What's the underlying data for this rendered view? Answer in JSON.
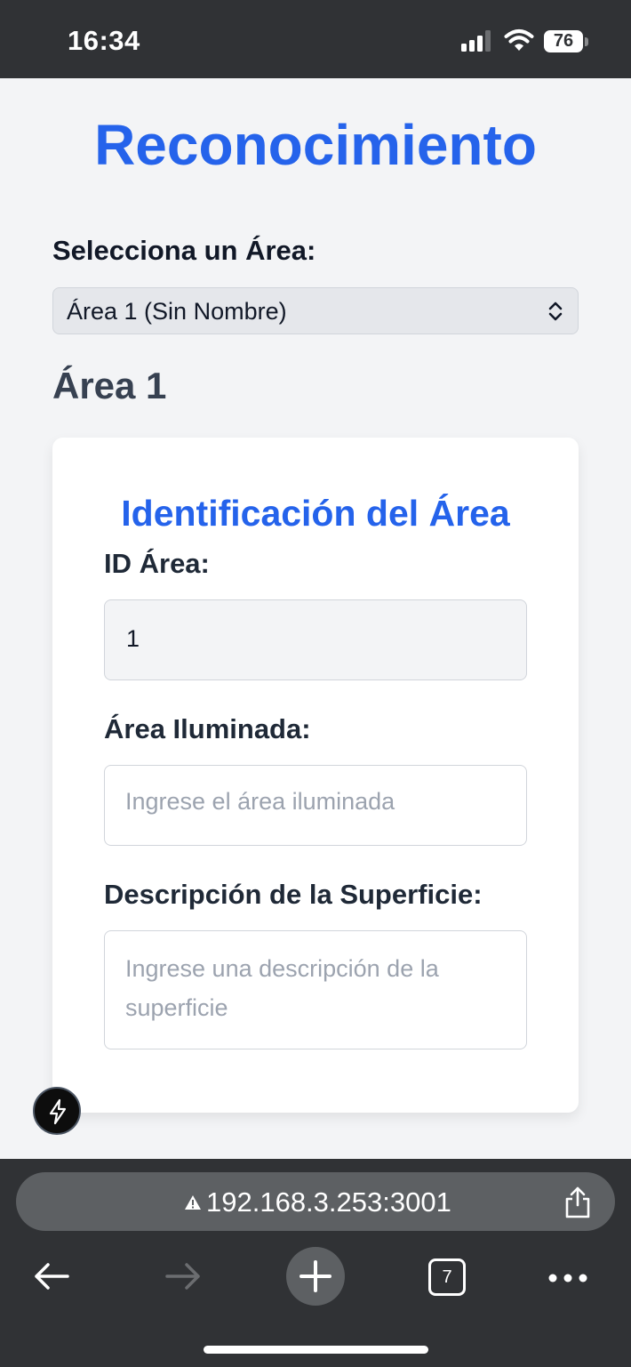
{
  "status_bar": {
    "time": "16:34",
    "battery": "76",
    "icons": [
      "cellular-signal-icon",
      "wifi-icon",
      "battery-icon"
    ]
  },
  "page": {
    "title": "Reconocimiento",
    "select_label": "Selecciona un Área:",
    "selected_area": "Área 1 (Sin Nombre)",
    "area_heading": "Área 1"
  },
  "card": {
    "title": "Identificación del Área",
    "id_label": "ID Área:",
    "id_value": "1",
    "illuminated_label": "Área Iluminada:",
    "illuminated_placeholder": "Ingrese el área iluminada",
    "surface_label": "Descripción de la Superficie:",
    "surface_placeholder": "Ingrese una descripción de la superficie"
  },
  "browser": {
    "url": "192.168.3.253:3001",
    "tab_count": "7",
    "icons": [
      "warning-icon",
      "share-icon",
      "back-arrow-icon",
      "forward-arrow-icon",
      "plus-icon",
      "tabs-icon",
      "more-icon",
      "lightning-icon"
    ]
  },
  "colors": {
    "accent": "#2563eb",
    "chrome": "#303235",
    "page_background": "#f3f4f6"
  }
}
